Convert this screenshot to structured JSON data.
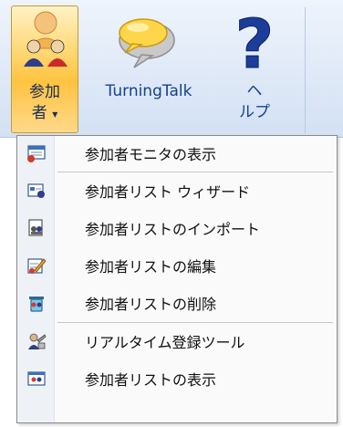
{
  "ribbon": {
    "participants_button": {
      "line1": "参加",
      "line2": "者",
      "arrow": "▾"
    },
    "turningtalk_button": {
      "label": "TurningTalk"
    },
    "help_button": {
      "line1": "ヘ",
      "line2": "ルプ"
    }
  },
  "menu": {
    "items": [
      {
        "label": "参加者モニタの表示",
        "icon": "monitor-icon"
      },
      {
        "label": "参加者リスト ウィザード",
        "icon": "wizard-icon"
      },
      {
        "label": "参加者リストのインポート",
        "icon": "import-icon"
      },
      {
        "label": "参加者リストの編集",
        "icon": "edit-icon"
      },
      {
        "label": "参加者リストの削除",
        "icon": "delete-icon"
      },
      {
        "label": "リアルタイム登録ツール",
        "icon": "realtime-register-icon"
      },
      {
        "label": "参加者リストの表示",
        "icon": "view-list-icon"
      }
    ]
  }
}
